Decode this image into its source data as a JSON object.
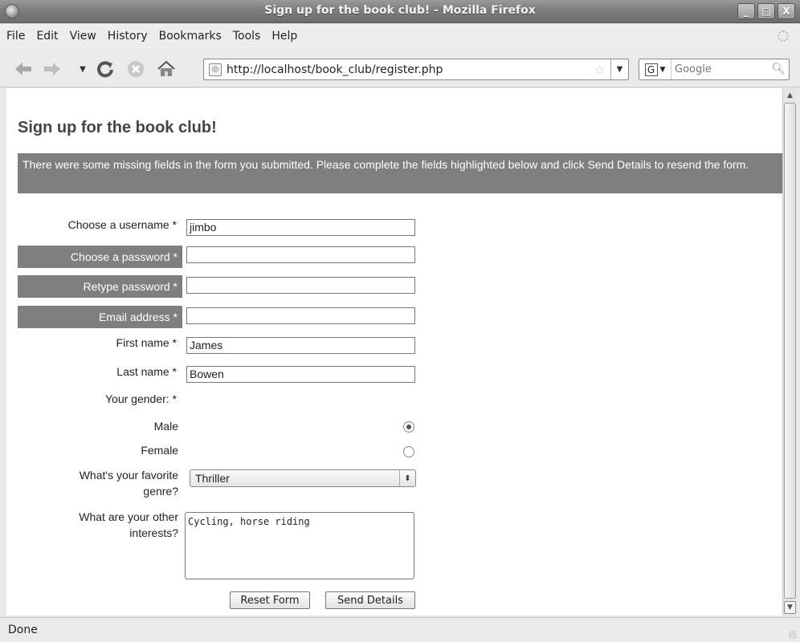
{
  "window": {
    "title": "Sign up for the book club! - Mozilla Firefox",
    "controls": [
      "_",
      "□",
      "X"
    ]
  },
  "menu": [
    "File",
    "Edit",
    "View",
    "History",
    "Bookmarks",
    "Tools",
    "Help"
  ],
  "toolbar": {
    "url": "http://localhost/book_club/register.php",
    "search_placeholder": "Google",
    "search_engine": "G"
  },
  "page": {
    "title": "Sign up for the book club!",
    "error_message": "There were some missing fields in the form you submitted. Please complete the fields highlighted below and click Send Details to resend the form.",
    "form": {
      "username_label": "Choose a username *",
      "username_value": "jimbo",
      "password_label": "Choose a password *",
      "password_value": "",
      "retype_label": "Retype password *",
      "retype_value": "",
      "email_label": "Email address *",
      "email_value": "",
      "firstname_label": "First name *",
      "firstname_value": "James",
      "lastname_label": "Last name *",
      "lastname_value": "Bowen",
      "gender_label": "Your gender: *",
      "male_label": "Male",
      "female_label": "Female",
      "gender_selected": "Male",
      "genre_label_line1": "What's your favorite",
      "genre_label_line2": "genre?",
      "genre_value": "Thriller",
      "interests_label_line1": "What are your other",
      "interests_label_line2": "interests?",
      "interests_value": "Cycling, horse riding",
      "reset_label": "Reset Form",
      "send_label": "Send Details"
    },
    "error_highlight_color": "#7f7f7f"
  },
  "status": {
    "text": "Done"
  }
}
